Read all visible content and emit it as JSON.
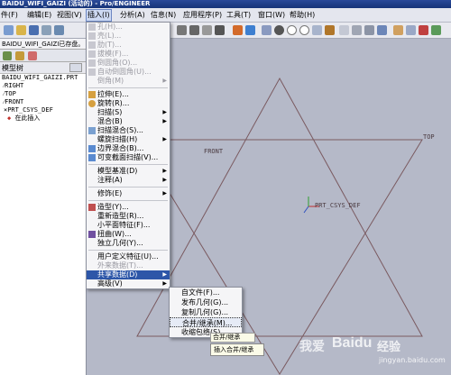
{
  "window": {
    "title": "BAIDU_WIFI_GAIZI (活动的) - Pro/ENGINEER"
  },
  "menubar": {
    "items": [
      {
        "label": "件(F)"
      },
      {
        "label": "编辑(E)"
      },
      {
        "label": "视图(V)"
      },
      {
        "label": "插入(I)"
      },
      {
        "label": "分析(A)"
      },
      {
        "label": "信息(N)"
      },
      {
        "label": "应用程序(P)"
      },
      {
        "label": "工具(T)"
      },
      {
        "label": "窗口(W)"
      },
      {
        "label": "帮助(H)"
      }
    ]
  },
  "message": {
    "text": "BAIDU_WIFI_GAIZI已存盘。"
  },
  "tree": {
    "title": "模型树",
    "items": [
      "BAIDU_WIFI_GAIZI.PRT",
      "RIGHT",
      "TOP",
      "FRONT",
      "PRT_CSYS_DEF",
      "在此插入"
    ]
  },
  "graphics": {
    "labels": {
      "front": "FRONT",
      "top": "TOP",
      "csys": "PRT_CSYS_DEF"
    }
  },
  "insert_menu": {
    "items": [
      {
        "label": "孔(H)...",
        "disabled": true
      },
      {
        "label": "壳(L)...",
        "disabled": true
      },
      {
        "label": "肋(T)...",
        "disabled": true
      },
      {
        "label": "拔模(F)...",
        "disabled": true
      },
      {
        "label": "倒圆角(O)...",
        "disabled": true
      },
      {
        "label": "自动倒圆角(U)...",
        "disabled": true
      },
      {
        "label": "倒角(M)",
        "disabled": true
      },
      {
        "label": "拉伸(E)...",
        "disabled": false
      },
      {
        "label": "旋转(R)...",
        "disabled": false
      },
      {
        "label": "扫描(S)",
        "disabled": false
      },
      {
        "label": "混合(B)",
        "disabled": false
      },
      {
        "label": "扫描混合(S)...",
        "disabled": false
      },
      {
        "label": "螺旋扫描(H)",
        "disabled": false
      },
      {
        "label": "边界混合(B)...",
        "disabled": false
      },
      {
        "label": "可变截面扫描(V)...",
        "disabled": false
      },
      {
        "label": "模型基准(D)",
        "disabled": false
      },
      {
        "label": "注释(A)",
        "disabled": false
      },
      {
        "label": "修饰(E)",
        "disabled": false
      },
      {
        "label": "造型(Y)...",
        "disabled": false
      },
      {
        "label": "重新造型(R)...",
        "disabled": false
      },
      {
        "label": "小平面特征(F)...",
        "disabled": false
      },
      {
        "label": "扭曲(W)...",
        "disabled": false
      },
      {
        "label": "独立几何(Y)...",
        "disabled": false
      },
      {
        "label": "用户定义特征(U)...",
        "disabled": false
      },
      {
        "label": "外来数据(T)...",
        "disabled": true
      },
      {
        "label": "共享数据(D)",
        "disabled": false
      },
      {
        "label": "高级(V)",
        "disabled": false
      }
    ]
  },
  "shared_data_menu": {
    "items": [
      {
        "label": "自文件(F)..."
      },
      {
        "label": "发布几何(G)..."
      },
      {
        "label": "复制几何(G)..."
      },
      {
        "label": "合并/继承(M)..."
      },
      {
        "label": "收缩包络(S)..."
      }
    ]
  },
  "tooltip": {
    "text": "插入合并/继承"
  },
  "tooltip_small": {
    "text": "合并/继承"
  },
  "watermark": {
    "brand": "Baidu",
    "suffix": "经验",
    "url": "jingyan.baidu.com",
    "logo_text": "我爱"
  }
}
